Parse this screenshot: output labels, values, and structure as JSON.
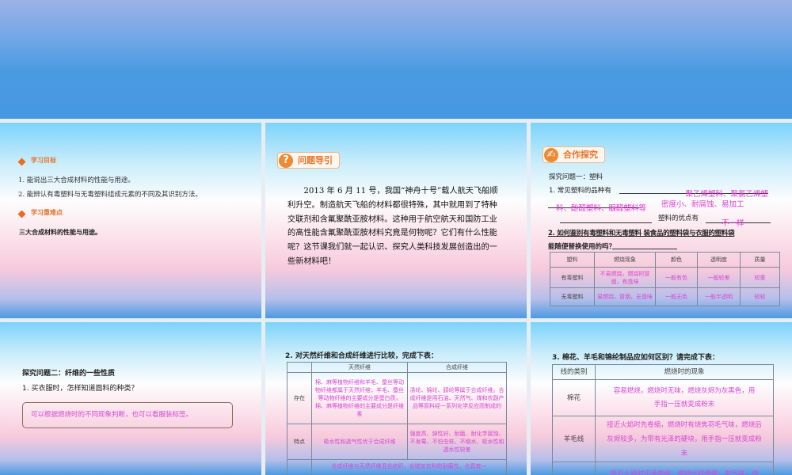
{
  "slide1": {
    "goal_heading": "学习目标",
    "goals": [
      "1. 能说出三大合成材料的性能与用途。",
      "2. 能辨认有毒塑料与无毒塑料组成元素的不同及其识别方法。"
    ],
    "key_heading": "学习重难点",
    "key_text": "三大合成材料的性能与用途。"
  },
  "slide2": {
    "badge": "问题导引",
    "paragraph": "2013 年 6 月 11 号，我国“神舟十号”载人航天飞船顺利升空。制造航天飞船的材料都很特殊，其中就用到了特种交联剂和含氟聚酰亚胺材料。这种用于航空航天和国防工业的高性能含氟聚酰亚胺材料究竟是何物呢？它们有什么性能呢？这节课我们就一起认识、探究人类科技发展创造出的一些新材料吧！"
  },
  "slide3": {
    "badge": "合作探究",
    "topic": "探究问题一：塑料",
    "q1_prefix": "1. 常见塑料的品种有",
    "q1_answer_a": "聚乙烯塑料、聚氯乙烯塑",
    "q1_answer_b": "料、酚醛塑料、脲醛塑料等",
    "q1_adv_answer": "密度小、耐腐蚀、易加工",
    "q1_adv_label": "塑料的优点有",
    "q1_adv_fill": "不一样",
    "q2_line1": "2. 如何鉴别有毒塑料和无毒塑料 装食品的塑料袋与衣服的塑料袋",
    "q2_line2": "能随便替换使用的吗？",
    "table": {
      "headers": [
        "塑料",
        "燃烧现象",
        "颜色",
        "透明度",
        "质量"
      ],
      "rows": [
        [
          "有毒塑料",
          "不易燃烧，燃烧时冒烟，有臭味",
          "一般有色",
          "一般较差",
          "较重"
        ],
        [
          "无毒塑料",
          "易燃烧，冒烟，无臭味",
          "一般无色",
          "一般半透明",
          "较轻"
        ]
      ]
    }
  },
  "slide4": {
    "topic": "探究问题二：纤维的一些性质",
    "question": "1. 买衣服时，怎样知道面料的种类？",
    "answer": "可以根据燃烧时的不同现象判断，也可以看服装标签。"
  },
  "slide5": {
    "title": "2. 对天然纤维和合成纤维进行比较，完成下表：",
    "headers": [
      "",
      "天然纤维",
      "合成纤维"
    ],
    "rows": [
      [
        "存在",
        "棉、麻等植物纤维和羊毛、蚕丝等动物纤维都属于天然纤维；羊毛、蚕丝等动物纤维的主要成分是蛋白质，棉、麻等植物纤维的主要成分是纤维素",
        "涤纶、锦纶、腈纶等属于合成纤维。合成纤维是用石油、天然气、煤和农副产品等原料经一系列化学反应而制成的"
      ],
      [
        "特点",
        "吸水性和透气性优于合成纤维",
        "强度高、弹性好、耐磨、耐化学腐蚀、不发霉、不怕虫蛀、不缩水、吸水性和透水性较差"
      ]
    ],
    "last_row": "合成纤维与天然纤维混合纺织，会增加衣料的耐磨性，也具有一"
  },
  "slide6": {
    "title": "3. 棉花、羊毛和锦纶制品应如何区别？请完成下表：",
    "headers": [
      "线的类别",
      "燃烧时的现象"
    ],
    "rows": [
      [
        "棉花",
        "容易燃烧，燃烧时无味，燃烧灰烬为灰黑色，用手指一压就变成粉末"
      ],
      [
        "羊毛线",
        "接近火焰时先卷缩，燃烧时有烧焦羽毛气味，燃烧后灰烬较多，为带有光泽的硬块，用手指一压就变成粉末"
      ]
    ],
    "last_row": "接近火焰时迅速卷缩，燃烧比较缓慢，有气味，烧"
  }
}
